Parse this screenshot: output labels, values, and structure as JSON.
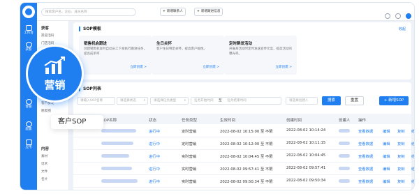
{
  "sidebar_rail": {
    "items": [
      {
        "label": "工作台",
        "icon": "monitor-icon"
      },
      {
        "label": "获客",
        "icon": "user-plus-icon"
      },
      {
        "label": "客户",
        "icon": "users-icon"
      },
      {
        "label": "营销",
        "icon": "chart-icon"
      },
      {
        "label": "客服",
        "icon": "chat-icon"
      },
      {
        "label": "配置",
        "icon": "gear-icon"
      },
      {
        "label": "应用",
        "icon": "apps-icon"
      }
    ]
  },
  "submenu": {
    "groups": [
      {
        "title": "获客",
        "items": [
          "渠道活码",
          "门店活码",
          "获客链接"
        ]
      },
      {
        "title": "运营",
        "items": [
          "人群分组",
          "客户群发",
          "朋友圈"
        ]
      },
      {
        "title": "内容",
        "items": [
          "素材",
          "话术",
          "文件",
          "名片"
        ]
      }
    ],
    "active_item": "SOP"
  },
  "topbar": {
    "search_placeholder": "搜索客户名、企业、成员名称",
    "buttons": [
      "新增联系人",
      "新增跟进信息"
    ]
  },
  "sop_templates": {
    "title": "SOP模板",
    "fold_label": "收起",
    "cards": [
      {
        "name": "销售机会跟进",
        "desc": "创建销售机会时自动员工下发执行跟进任务，提高成单率",
        "action": "立即创建 >"
      },
      {
        "name": "生日关怀",
        "desc": "客户生日特定关怀，提高客户黏性。",
        "action": "立即创建 >"
      },
      {
        "name": "定时群发活动",
        "desc": "开展某活动时定时发送宣传文案，提高活动的曝光率。",
        "action": "立即创建 >"
      }
    ]
  },
  "sop_list": {
    "title": "SOP列表",
    "filters": [
      {
        "placeholder": "请输入SOP名称",
        "dropdown": false
      },
      {
        "placeholder": "请选择状态",
        "dropdown": true
      },
      {
        "placeholder": "请选择任务类型",
        "dropdown": true
      },
      {
        "placeholder": "任务开始时间",
        "dropdown": false
      },
      {
        "placeholder": "任务结束时间",
        "dropdown": false
      },
      {
        "placeholder": "请选择创建人",
        "dropdown": false
      }
    ],
    "date_sep": "至",
    "search_label": "搜索",
    "reset_label": "重置",
    "new_label": "+ 新增SOP",
    "columns": [
      "SOP名称",
      "状态",
      "任务类型",
      "生效时间",
      "创建时间",
      "创建人",
      "操作"
    ],
    "rows": [
      {
        "status": "进行中",
        "type": "定时营销",
        "effective": "2022-08-02 10:15:00 至 不限",
        "created": "2022-08-02 10:14:24",
        "actions": [
          "查看数据",
          "编辑",
          "复制",
          "结束"
        ]
      },
      {
        "status": "进行中",
        "type": "定时营销",
        "effective": "2022-08-02 10:12:00 至 不限",
        "created": "2022-08-02 10:11:15",
        "actions": [
          "查看数据",
          "编辑",
          "复制",
          "结束"
        ]
      },
      {
        "status": "进行中",
        "type": "实时营销",
        "effective": "2022-08-02 10:04:45 至 不限",
        "created": "2022-08-02 10:04:45",
        "actions": [
          "查看数据",
          "编辑",
          "复制",
          "结束"
        ]
      },
      {
        "status": "进行中",
        "type": "实时营销",
        "effective": "2022-08-02 09:57:41 至 不限",
        "created": "2022-08-02 09:57:41",
        "actions": [
          "查看数据",
          "编辑",
          "复制",
          "结束"
        ]
      },
      {
        "status": "进行中",
        "type": "实时营销",
        "effective": "2022-08-02 09:50:34 至 不限",
        "created": "2022-08-02 09:50:34",
        "actions": [
          "查看数据",
          "编辑",
          "复制",
          "结束"
        ]
      }
    ]
  },
  "highlight": {
    "badge_label": "营销",
    "tooltip_label": "客户SOP"
  },
  "colors": {
    "accent": "#1f7ef0",
    "rail": "#1f7ef0",
    "page_bg": "#eef2f8"
  }
}
